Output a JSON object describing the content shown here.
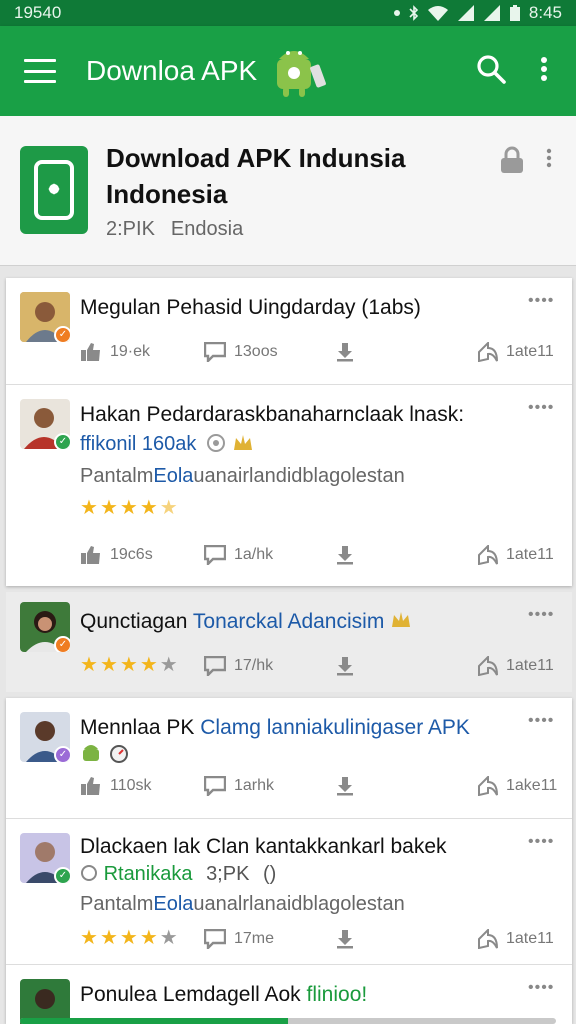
{
  "status_bar": {
    "time_left": "19540",
    "time_right": "8:45"
  },
  "app_bar": {
    "title": "Downloa APK"
  },
  "app_header": {
    "title_line1": "Download APK Indunsia",
    "title_line2": "Indonesia",
    "meta": [
      "2:PIK",
      "Endosia"
    ]
  },
  "colors": {
    "primary": "#19a046",
    "primary_dark": "#0f7a37",
    "link": "#1d5aa8",
    "star": "#f3b51b"
  },
  "posts": [
    {
      "title": "Megulan Pehasid Uingdarday (1abs)",
      "likes": "19·ek",
      "comments": "13oos",
      "share": "1ate11"
    },
    {
      "title": "Hakan Pedardaraskbanaharnclaak lnask:",
      "link": "ffikonil 160ak",
      "desc": "Pantalm",
      "desc_link": "Eola",
      "desc_rest": "uanairlandidblagolestan",
      "rating": 4.5,
      "likes": "19c6s",
      "comments": "1a/hk",
      "share": "1ate11"
    },
    {
      "title": "Qunctiаgan",
      "title_link": "Tonarckal Adancisim",
      "rating": 4,
      "comments": "17/hk",
      "share": "1ate11"
    },
    {
      "title": "Mennlaa PK",
      "title_link": "Clamg lanniakulinigaser APK",
      "likes": "110sk",
      "comments": "1arhk",
      "share": "1ake11"
    },
    {
      "title": "Dlackaen lak  Clan kantakkankarl bakek",
      "link": "Rtanikaka",
      "meta": "3;PK",
      "desc": "Pantalm",
      "desc_link": "Eola",
      "desc_rest": "uanalrlanaidblagolestan",
      "rating": 4,
      "comments": "17me",
      "share": "1ate11"
    },
    {
      "title": "Ponulea Lemdagell Aok",
      "title_link": "flinioo!"
    }
  ],
  "progress": {
    "value": 0.5
  }
}
